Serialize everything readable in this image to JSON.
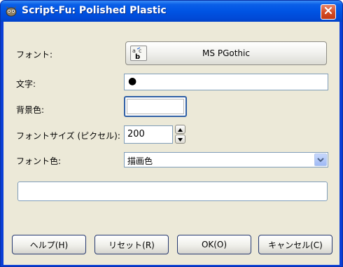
{
  "window": {
    "title": "Script-Fu: Polished Plastic",
    "icon": "gimp-icon",
    "close_icon": "close-icon"
  },
  "fields": {
    "font_label": "フォント:",
    "font_value": "MS PGothic",
    "font_icon": "font-sample-icon",
    "text_label": "文字:",
    "text_value": "●",
    "background_label": "背景色:",
    "background_color": "#ffffff",
    "fontsize_label": "フォントサイズ (ピクセル):",
    "fontsize_value": "200",
    "fontcolor_label": "フォント色:",
    "fontcolor_value": "描画色",
    "progress_text": ""
  },
  "buttons": {
    "help": "ヘルプ(H)",
    "reset": "リセット(R)",
    "ok": "OK(O)",
    "cancel": "キャンセル(C)"
  },
  "colors": {
    "titlebar": "#0054e3",
    "dialog_bg": "#ece9d8",
    "close_button": "#d44a23"
  }
}
